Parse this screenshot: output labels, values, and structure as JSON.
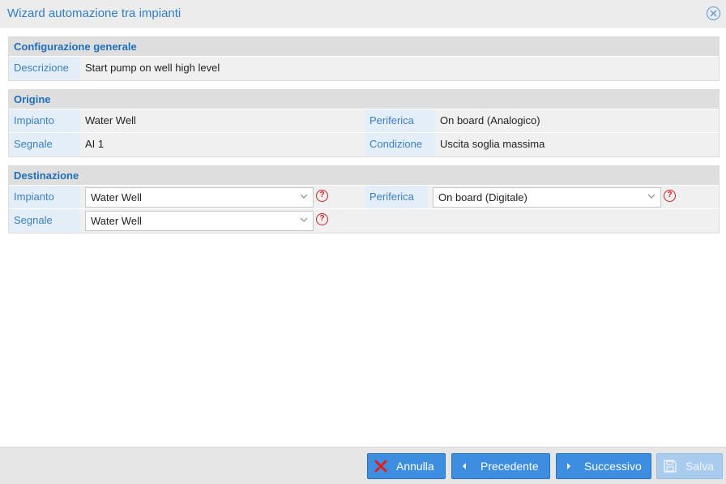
{
  "window": {
    "title": "Wizard automazione tra impianti",
    "close_icon": "close-circle-icon"
  },
  "general": {
    "header": "Configurazione generale",
    "description_label": "Descrizione",
    "description_value": "Start pump on well high level"
  },
  "origin": {
    "header": "Origine",
    "plant_label": "Impianto",
    "plant_value": "Water Well",
    "peripheral_label": "Periferica",
    "peripheral_value": "On board (Analogico)",
    "signal_label": "Segnale",
    "signal_value": "AI 1",
    "condition_label": "Condizione",
    "condition_value": "Uscita soglia massima"
  },
  "destination": {
    "header": "Destinazione",
    "plant_label": "Impianto",
    "plant_selected": "Water Well",
    "peripheral_label": "Periferica",
    "peripheral_selected": "On board (Digitale)",
    "signal_label": "Segnale",
    "signal_selected": "Water Well",
    "help_glyph": "?"
  },
  "footer": {
    "cancel_label": "Annulla",
    "previous_label": "Precedente",
    "next_label": "Successivo",
    "save_label": "Salva"
  },
  "colors": {
    "accent": "#2f7fc4",
    "button_primary": "#3d8de0",
    "button_disabled": "#a9cbee",
    "help_red": "#d02020",
    "cancel_x": "#e02020"
  }
}
